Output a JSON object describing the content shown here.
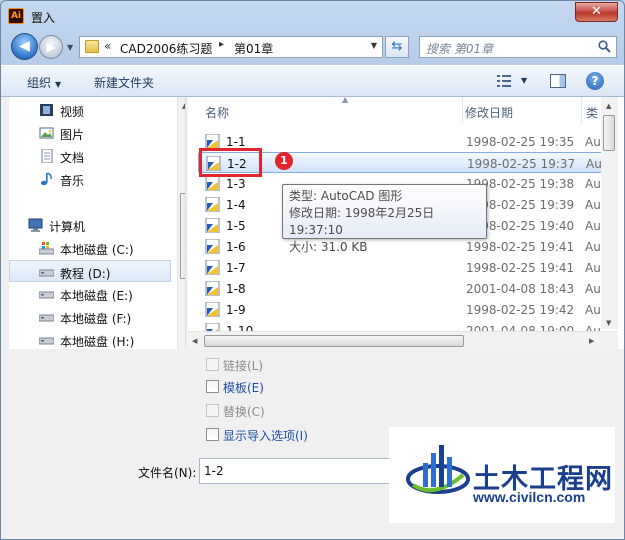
{
  "window": {
    "title": "置入",
    "app_icon": "Ai",
    "close_glyph": "✕"
  },
  "nav": {
    "back_glyph": "◀",
    "fwd_glyph": "▶",
    "address_chevron": "«",
    "address_segments": [
      "CAD2006练习题",
      "第01章"
    ],
    "address_sep": "▸",
    "search_placeholder": "搜索 第01章"
  },
  "toolbar": {
    "organize": "组织",
    "new_folder": "新建文件夹",
    "help": "?"
  },
  "sidebar": {
    "items": [
      {
        "label": "视频",
        "icon": "video-library-icon"
      },
      {
        "label": "图片",
        "icon": "pictures-library-icon"
      },
      {
        "label": "文档",
        "icon": "documents-library-icon"
      },
      {
        "label": "音乐",
        "icon": "music-library-icon"
      },
      {
        "label": "计算机",
        "icon": "computer-icon"
      },
      {
        "label": "本地磁盘 (C:)",
        "icon": "system-drive-icon"
      },
      {
        "label": "教程 (D:)",
        "icon": "drive-icon",
        "selected": true
      },
      {
        "label": "本地磁盘 (E:)",
        "icon": "drive-icon"
      },
      {
        "label": "本地磁盘 (F:)",
        "icon": "drive-icon"
      },
      {
        "label": "本地磁盘 (H:)",
        "icon": "drive-icon"
      }
    ]
  },
  "files": {
    "columns": [
      "名称",
      "修改日期",
      "类"
    ],
    "rows": [
      {
        "name": "1-1",
        "date": "1998-02-25 19:35",
        "type": "Au"
      },
      {
        "name": "1-2",
        "date": "1998-02-25 19:37",
        "type": "Au",
        "selected": true
      },
      {
        "name": "1-3",
        "date": "1998-02-25 19:38",
        "type": "Au"
      },
      {
        "name": "1-4",
        "date": "1998-02-25 19:39",
        "type": "Au"
      },
      {
        "name": "1-5",
        "date": "1998-02-25 19:40",
        "type": "Au"
      },
      {
        "name": "1-6",
        "date": "1998-02-25 19:41",
        "type": "Au"
      },
      {
        "name": "1-7",
        "date": "1998-02-25 19:41",
        "type": "Au"
      },
      {
        "name": "1-8",
        "date": "2001-04-08 18:43",
        "type": "Au"
      },
      {
        "name": "1-9",
        "date": "1998-02-25 19:42",
        "type": "Au"
      },
      {
        "name": "1-10",
        "date": "2001-04-08 19:00",
        "type": "Au"
      }
    ]
  },
  "tooltip": {
    "type": "类型: AutoCAD 图形",
    "modified": "修改日期: 1998年2月25日 19:37:10",
    "size": "大小: 31.0 KB"
  },
  "annotation": {
    "badge": "1",
    "color": "#e3262d"
  },
  "options": {
    "link": "链接(L)",
    "template": "模板(E)",
    "replace": "替换(C)",
    "show_import": "显示导入选项(I)"
  },
  "filename": {
    "label": "文件名(N):",
    "value": "1-2"
  },
  "watermark": {
    "title": "土木工程网",
    "url": "www.civilcn.com"
  }
}
